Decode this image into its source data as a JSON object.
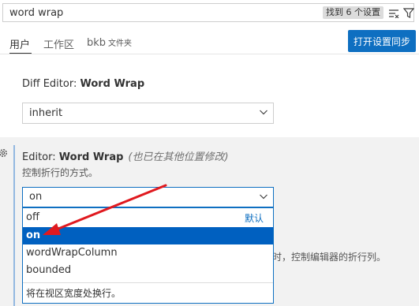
{
  "search": {
    "query": "word wrap",
    "result_count": "找到 6 个设置",
    "clear_icon": "clear-filter-icon",
    "filter_icon": "filter-icon"
  },
  "tabs": [
    {
      "label": "用户",
      "active": true
    },
    {
      "label": "工作区",
      "active": false
    },
    {
      "label": "bkb",
      "sub": "文件夹",
      "active": false
    }
  ],
  "sync_button": "打开设置同步",
  "settings": [
    {
      "category": "Diff Editor: ",
      "name": "Word Wrap",
      "value": "inherit"
    },
    {
      "category": "Editor: ",
      "name": "Word Wrap",
      "modified_note": "(也已在其他位置修改)",
      "description": "控制折行的方式。",
      "value": "on",
      "options": [
        {
          "label": "off",
          "badge": "默认"
        },
        {
          "label": "on",
          "selected": true
        },
        {
          "label": "wordWrapColumn"
        },
        {
          "label": "bounded"
        }
      ],
      "option_description": "将在视区宽度处换行。"
    }
  ],
  "background_text": "时，控制编辑器的折行列。",
  "colors": {
    "accent": "#0e6fc1",
    "selected_option": "#0060c0",
    "annotation_arrow": "#e0191f"
  }
}
